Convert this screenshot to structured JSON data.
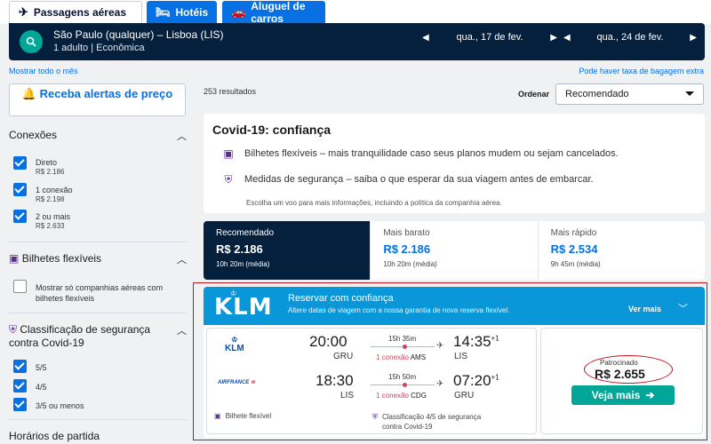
{
  "tabs": [
    {
      "label": "Passagens aéreas",
      "icon": "plane-icon"
    },
    {
      "label": "Hotéis",
      "icon": "bed-icon"
    },
    {
      "label": "Aluguel de carros",
      "icon": "car-icon"
    }
  ],
  "search": {
    "route": "São Paulo (qualquer) – Lisboa (LIS)",
    "passengers": "1 adulto",
    "cabin": "Econômica",
    "depart_date": "qua., 17 de fev.",
    "return_date": "qua., 24 de fev."
  },
  "links": {
    "show_month": "Mostrar todo o mês",
    "baggage": "Pode haver taxa de bagagem extra"
  },
  "sidebar": {
    "alert_button": "Receba alertas de preço",
    "connections": {
      "title": "Conexões",
      "options": [
        {
          "label": "Direto",
          "price": "R$ 2.186",
          "checked": true
        },
        {
          "label": "1 conexão",
          "price": "R$ 2.198",
          "checked": true
        },
        {
          "label": "2 ou mais",
          "price": "R$ 2.633",
          "checked": true
        }
      ]
    },
    "flexible": {
      "title": "Bilhetes flexíveis",
      "option_line1": "Mostrar só companhias aéreas com",
      "option_line2": "bilhetes flexíveis",
      "checked": false
    },
    "safety": {
      "title_line1": "Classificação de segurança",
      "title_line2": "contra Covid-19",
      "options": [
        {
          "label": "5/5",
          "checked": true
        },
        {
          "label": "4/5",
          "checked": true
        },
        {
          "label": "3/5 ou menos",
          "checked": true
        }
      ]
    },
    "departure": {
      "title": "Horários de partida"
    }
  },
  "main": {
    "results": "253 resultados",
    "order_label": "Ordenar",
    "order_value": "Recomendado"
  },
  "covid": {
    "title": "Covid-19: confiança",
    "row1": "Bilhetes flexíveis – mais tranquilidade caso seus planos mudem ou sejam cancelados.",
    "row2": "Medidas de segurança – saiba o que esperar da sua viagem antes de embarcar.",
    "note": "Escolha um voo para mais informações, incluindo a política da companhia aérea."
  },
  "sort_tabs": [
    {
      "label": "Recomendado",
      "price": "R$ 2.186",
      "duration": "10h 20m (média)",
      "active": true
    },
    {
      "label": "Mais barato",
      "price": "R$ 2.186",
      "duration": "10h 20m (média)",
      "active": false
    },
    {
      "label": "Mais rápido",
      "price": "R$ 2.534",
      "duration": "9h 45m (média)",
      "active": false
    }
  ],
  "ad": {
    "brand": "KLM",
    "title": "Reservar com confiança",
    "subtitle": "Altere datas de viagem com a nossa garantia de nova reserva flexível.",
    "more": "Ver mais",
    "outbound": {
      "airline": "KLM",
      "dep_time": "20:00",
      "dep_code": "GRU",
      "duration": "15h 35m",
      "stops": "1 conexão",
      "stop_code": "AMS",
      "arr_time": "14:35",
      "arr_offset": "+1",
      "arr_code": "LIS"
    },
    "inbound": {
      "airline": "AIRFRANCE",
      "dep_time": "18:30",
      "dep_code": "LIS",
      "duration": "15h 50m",
      "stops": "1 conexão",
      "stop_code": "CDG",
      "arr_time": "07:20",
      "arr_offset": "+1",
      "arr_code": "GRU"
    },
    "footer_flex": "Bilhete flexível",
    "footer_safety_line1": "Classificação 4/5 de segurança",
    "footer_safety_line2": "contra Covid-19",
    "sponsored": "Patrocinado",
    "price": "R$ 2.655",
    "cta": "Veja mais"
  },
  "colors": {
    "navy": "#05203c",
    "blue": "#0770e3",
    "teal": "#00a698",
    "ad_blue": "#0a97d9",
    "highlight_red": "#c0141e"
  }
}
